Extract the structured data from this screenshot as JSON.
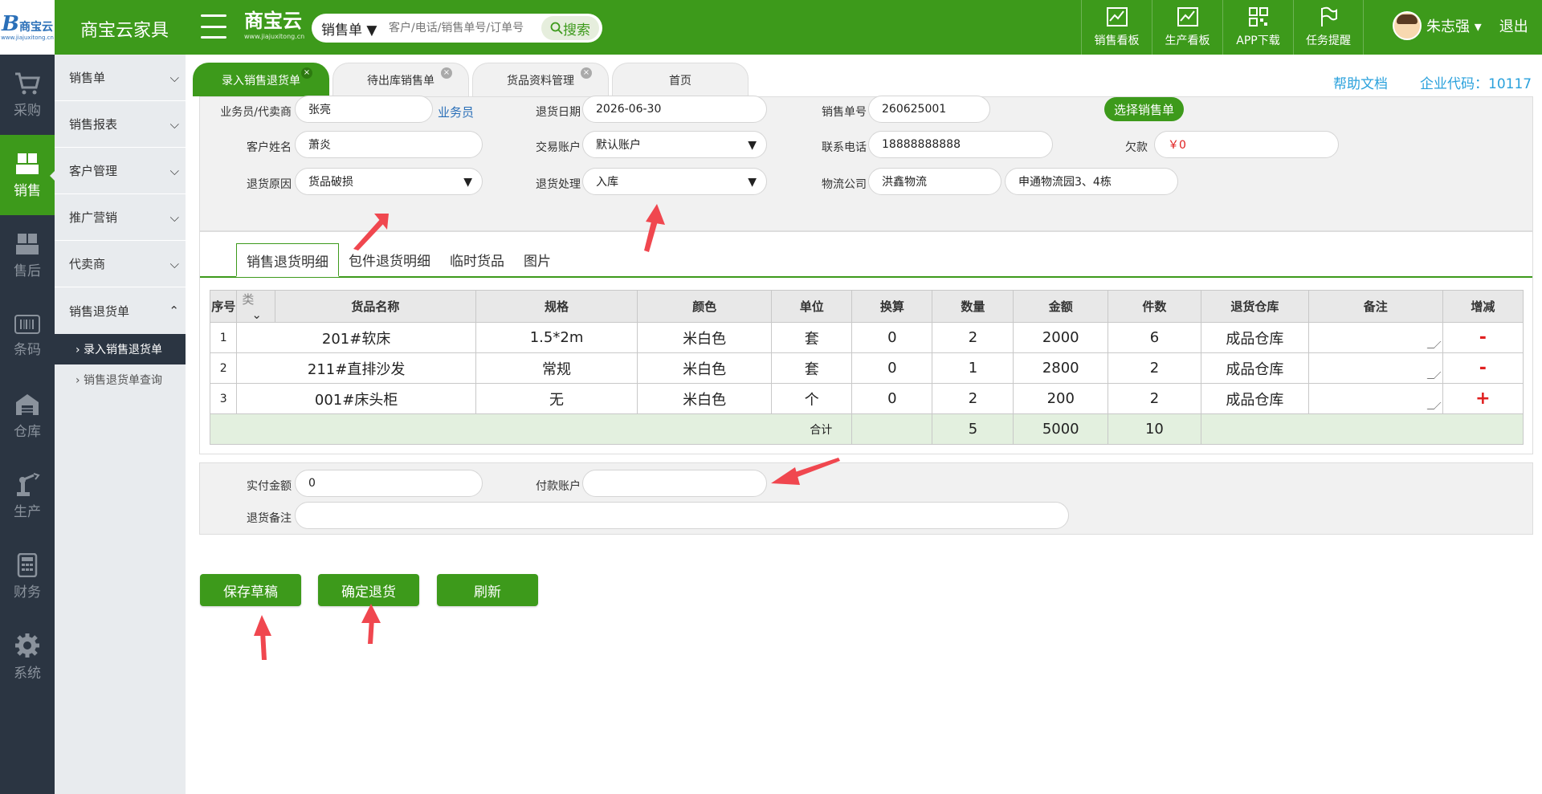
{
  "header": {
    "company": "商宝云家具",
    "brand_title": "商宝云",
    "brand_url": "www.jiajuxitong.cn",
    "logo_text": "商宝云",
    "search_type": "销售单 ▼",
    "search_placeholder": "客户/电话/销售单号/订单号",
    "search_button": "搜索",
    "nav": [
      "销售看板",
      "生产看板",
      "APP下载",
      "任务提醒"
    ],
    "user_name": "朱志强 ▾",
    "logout": "退出"
  },
  "iconbar": [
    "采购",
    "销售",
    "售后",
    "条码",
    "仓库",
    "生产",
    "财务",
    "系统"
  ],
  "submenu": {
    "groups": [
      "销售单",
      "销售报表",
      "客户管理",
      "推广营销",
      "代卖商",
      "销售退货单"
    ],
    "children": [
      "› 录入销售退货单",
      "› 销售退货单查询"
    ]
  },
  "tabs": [
    "录入销售退货单",
    "待出库销售单",
    "货品资料管理",
    "首页"
  ],
  "help_link": "帮助文档",
  "corp_code": "企业代码：10117",
  "form": {
    "salesman_label": "业务员/代卖商",
    "salesman_value": "张亮",
    "salesman_link": "业务员",
    "return_date_label": "退货日期",
    "return_date_value": "2026-06-30",
    "sales_no_label": "销售单号",
    "sales_no_value": "260625001",
    "select_order_button": "选择销售单",
    "customer_label": "客户姓名",
    "customer_value": "萧炎",
    "account_label": "交易账户",
    "account_value": "默认账户",
    "phone_label": "联系电话",
    "phone_value": "18888888888",
    "debt_label": "欠款",
    "debt_value": "￥0",
    "reason_label": "退货原因",
    "reason_value": "货品破损",
    "handling_label": "退货处理",
    "handling_value": "入库",
    "logistics_label": "物流公司",
    "logistics_value": "洪鑫物流",
    "logistics_address": "申通物流园3、4栋"
  },
  "detail_tabs": [
    "销售退货明细",
    "包件退货明细",
    "临时货品",
    "图片"
  ],
  "table": {
    "headers": [
      "序号",
      "类",
      "货品名称",
      "规格",
      "颜色",
      "单位",
      "换算",
      "数量",
      "金额",
      "件数",
      "退货仓库",
      "备注",
      "增减"
    ],
    "rows": [
      [
        "1",
        "201#软床",
        "1.5*2m",
        "米白色",
        "套",
        "0",
        "2",
        "2000",
        "6",
        "成品仓库",
        "",
        "-"
      ],
      [
        "2",
        "211#直排沙发",
        "常规",
        "米白色",
        "套",
        "0",
        "1",
        "2800",
        "2",
        "成品仓库",
        "",
        "-"
      ],
      [
        "3",
        "001#床头柜",
        "无",
        "米白色",
        "个",
        "0",
        "2",
        "200",
        "2",
        "成品仓库",
        "",
        "+"
      ]
    ],
    "total_label": "合计",
    "total_qty": "5",
    "total_amount": "5000",
    "total_pieces": "10"
  },
  "payment": {
    "paid_label": "实付金额",
    "paid_value": "0",
    "pay_account_label": "付款账户",
    "pay_account_value": "",
    "remark_label": "退货备注",
    "remark_value": ""
  },
  "buttons": {
    "save_draft": "保存草稿",
    "confirm": "确定退货",
    "refresh": "刷新"
  },
  "colors": {
    "primary_green": "#3d9a1b",
    "sidebar_dark": "#2b3542",
    "link_blue": "#2aa1dc",
    "annotation_red": "#f0474f"
  }
}
